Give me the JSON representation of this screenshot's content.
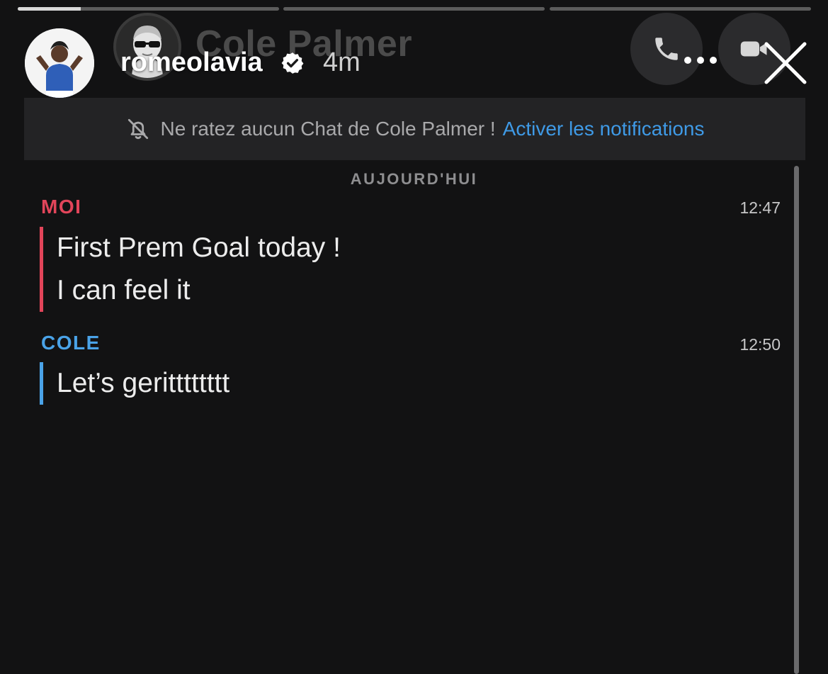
{
  "story": {
    "progress": [
      0.24,
      0,
      0
    ],
    "poster_name": "romeolavia",
    "age": "4m"
  },
  "snap_header": {
    "contact_name": "Cole Palmer"
  },
  "notification_banner": {
    "text": "Ne ratez aucun Chat de Cole Palmer !",
    "action": "Activer les notifications"
  },
  "chat": {
    "date_label": "AUJOURD'HUI",
    "groups": [
      {
        "sender": "MOI",
        "time": "12:47",
        "lines": [
          "First Prem Goal today !",
          "I can feel it"
        ]
      },
      {
        "sender": "COLE",
        "time": "12:50",
        "lines": [
          "Let’s geritttttttt"
        ]
      }
    ]
  },
  "colors": {
    "me": "#e2455a",
    "friend": "#4aa3e8",
    "link": "#3f9ae6"
  },
  "icons": [
    "verified-icon",
    "more-icon",
    "close-icon",
    "phone-icon",
    "video-icon",
    "bell-off-icon"
  ]
}
